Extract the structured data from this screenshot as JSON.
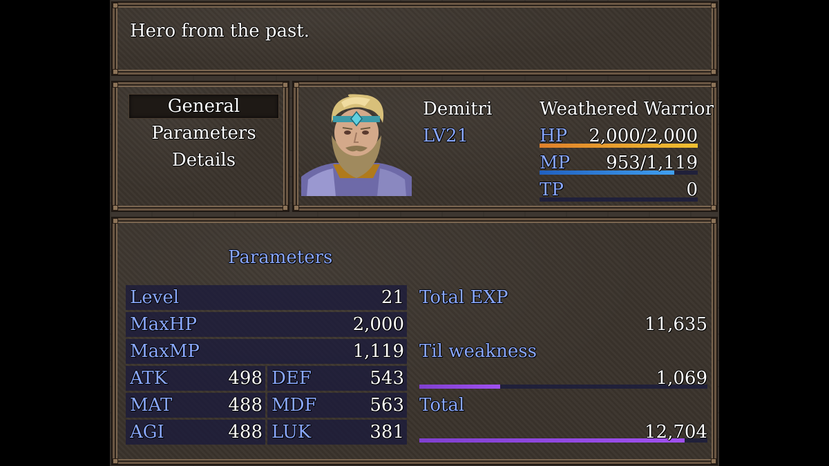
{
  "help": {
    "text": "Hero from the past."
  },
  "menu": {
    "items": [
      "General",
      "Parameters",
      "Details"
    ],
    "selected": 0
  },
  "actor": {
    "name": "Demitri",
    "nickname": "Weathered Warrior",
    "level_label": "LV",
    "level": "21",
    "level_text": "LV21",
    "hp_label": "HP",
    "hp_text": "2,000/2,000",
    "hp_ratio": 1.0,
    "mp_label": "MP",
    "mp_text": "953/1,119",
    "mp_ratio": 0.8517,
    "tp_label": "TP",
    "tp_text": "0",
    "tp_ratio": 0.0,
    "colors": {
      "hp": [
        "#e0802b",
        "#f0c030"
      ],
      "mp": [
        "#2060c0",
        "#40a0f0"
      ],
      "system": "#8aa8ff"
    }
  },
  "params": {
    "header": "Parameters",
    "single_rows": [
      {
        "label": "Level",
        "value": "21"
      },
      {
        "label": "MaxHP",
        "value": "2,000"
      },
      {
        "label": "MaxMP",
        "value": "1,119"
      }
    ],
    "pair_rows": [
      {
        "l_label": "ATK",
        "l_value": "498",
        "r_label": "DEF",
        "r_value": "543"
      },
      {
        "l_label": "MAT",
        "l_value": "488",
        "r_label": "MDF",
        "r_value": "563"
      },
      {
        "l_label": "AGI",
        "l_value": "488",
        "r_label": "LUK",
        "r_value": "381"
      }
    ]
  },
  "exp": {
    "total_label": "Total EXP",
    "total_value": "11,635",
    "next_label": "Til weakness",
    "next_value": "1,069",
    "next_ratio": 0.28,
    "sum_label": "Total",
    "sum_value": "12,704",
    "sum_ratio": 0.92,
    "bar_color": "#a050f0"
  }
}
